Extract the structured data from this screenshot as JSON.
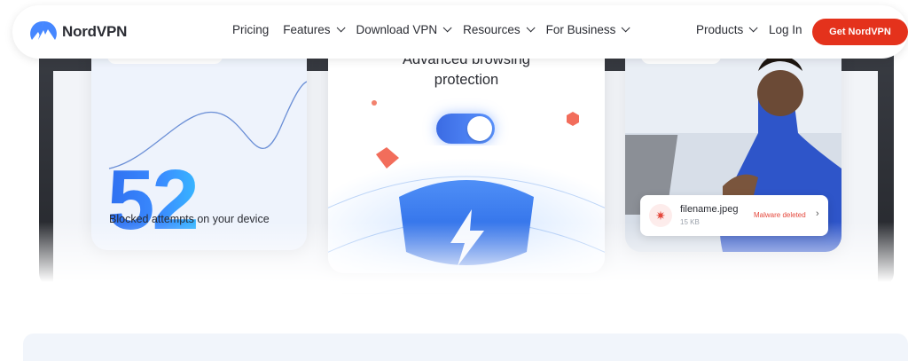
{
  "header": {
    "logo_text": "NordVPN",
    "logo_icon": "nordvpn-mountain-icon",
    "nav": [
      {
        "label": "Pricing",
        "has_dropdown": false
      },
      {
        "label": "Features",
        "has_dropdown": true
      },
      {
        "label": "Download VPN",
        "has_dropdown": true
      },
      {
        "label": "Resources",
        "has_dropdown": true
      },
      {
        "label": "For Business",
        "has_dropdown": true
      }
    ],
    "products_label": "Products",
    "login_label": "Log In",
    "cta_label": "Get NordVPN"
  },
  "cards": {
    "left": {
      "number": "52",
      "caption": "Blocked attempts on your device"
    },
    "center": {
      "title": "Advanced browsing protection",
      "toggle_on": true
    },
    "right": {
      "toast": {
        "filename": "filename.jpeg",
        "size": "15 KB",
        "status": "Malware deleted",
        "status_icon": "bug-icon",
        "chevron_icon": "chevron-right-icon"
      }
    }
  },
  "colors": {
    "brand_red": "#e4321c",
    "accent_blue": "#2f7bf5",
    "danger": "#e4473b"
  }
}
